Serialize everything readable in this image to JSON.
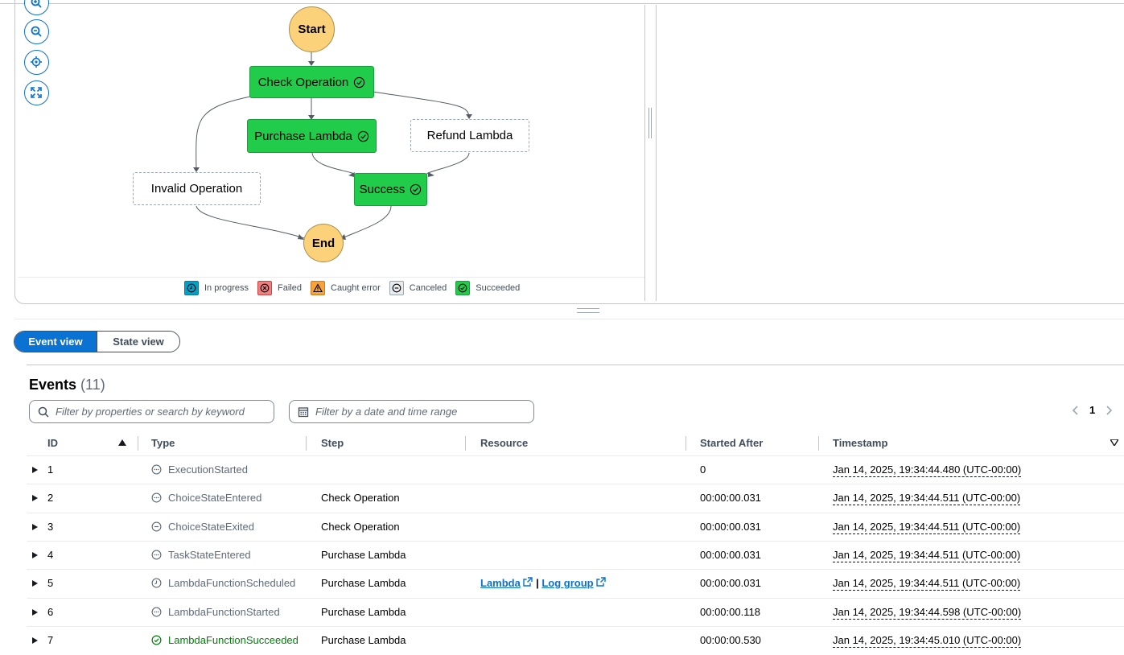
{
  "graph": {
    "states": {
      "start": "Start",
      "check_operation": "Check Operation",
      "purchase_lambda": "Purchase Lambda",
      "refund_lambda": "Refund Lambda",
      "invalid_operation": "Invalid Operation",
      "success": "Success",
      "end": "End"
    },
    "zoom_controls": [
      "zoom-in-icon",
      "zoom-out-icon",
      "center-icon",
      "fit-icon"
    ],
    "legend": [
      {
        "label": "In progress",
        "color": "#00a1c9",
        "icon": "clock-icon"
      },
      {
        "label": "Failed",
        "color": "#d13212",
        "icon": "x-circle-icon"
      },
      {
        "label": "Caught error",
        "color": "#f89256",
        "icon": "warning-icon"
      },
      {
        "label": "Canceled",
        "color": "#d5dbdb",
        "icon": "minus-circle-icon"
      },
      {
        "label": "Succeeded",
        "color": "#1fc94b",
        "icon": "check-circle-icon"
      }
    ]
  },
  "view_toggle": {
    "event_view": "Event view",
    "state_view": "State view",
    "selected": "Event view"
  },
  "events": {
    "title": "Events",
    "count": "(11)",
    "filter_placeholder": "Filter by properties or search by keyword",
    "date_placeholder": "Filter by a date and time range",
    "page": "1",
    "columns": [
      "ID",
      "Type",
      "Step",
      "Resource",
      "Started After",
      "Timestamp"
    ],
    "rows": [
      {
        "id": "1",
        "type": "ExecutionStarted",
        "status": "neutral",
        "step": "",
        "started_after": "0",
        "timestamp": "Jan 14, 2025, 19:34:44.480 (UTC-00:00)"
      },
      {
        "id": "2",
        "type": "ChoiceStateEntered",
        "status": "neutral",
        "step": "Check Operation",
        "started_after": "00:00:00.031",
        "timestamp": "Jan 14, 2025, 19:34:44.511 (UTC-00:00)"
      },
      {
        "id": "3",
        "type": "ChoiceStateExited",
        "status": "minus",
        "step": "Check Operation",
        "started_after": "00:00:00.031",
        "timestamp": "Jan 14, 2025, 19:34:44.511 (UTC-00:00)"
      },
      {
        "id": "4",
        "type": "TaskStateEntered",
        "status": "neutral",
        "step": "Purchase Lambda",
        "started_after": "00:00:00.031",
        "timestamp": "Jan 14, 2025, 19:34:44.511 (UTC-00:00)"
      },
      {
        "id": "5",
        "type": "LambdaFunctionScheduled",
        "status": "clock",
        "step": "Purchase Lambda",
        "resource": {
          "lambda": "Lambda",
          "sep": "|",
          "log_group": "Log group"
        },
        "started_after": "00:00:00.031",
        "timestamp": "Jan 14, 2025, 19:34:44.511 (UTC-00:00)"
      },
      {
        "id": "6",
        "type": "LambdaFunctionStarted",
        "status": "neutral",
        "step": "Purchase Lambda",
        "started_after": "00:00:00.118",
        "timestamp": "Jan 14, 2025, 19:34:44.598 (UTC-00:00)"
      },
      {
        "id": "7",
        "type": "LambdaFunctionSucceeded",
        "status": "success",
        "step": "Purchase Lambda",
        "started_after": "00:00:00.530",
        "timestamp": "Jan 14, 2025, 19:34:45.010 (UTC-00:00)"
      }
    ]
  }
}
